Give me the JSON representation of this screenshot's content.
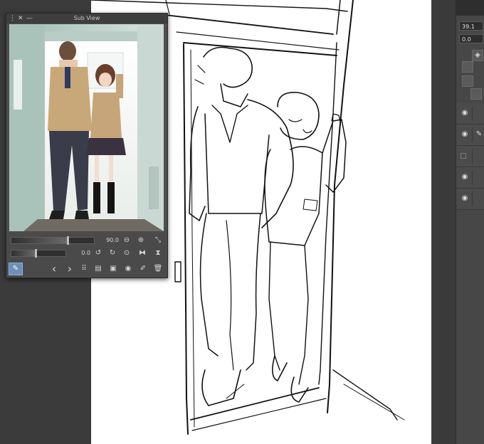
{
  "subview": {
    "title": "Sub View",
    "close_glyph": "✕",
    "minimize_glyph": "—",
    "zoom_value": "90.0",
    "rotate_value": "0.0",
    "zoom_level": 0.68,
    "rotate_level": 0.45
  },
  "right_panel": {
    "field1": "39.1",
    "field2": "0.0"
  },
  "icons": {
    "zoom_out": "⊖",
    "zoom_in": "⊕",
    "fit": "⤡",
    "rotate_left": "↺",
    "rotate_right": "↻",
    "reset": "⊙",
    "flip_h": "⧓",
    "flip_v": "⧗",
    "eyedropper": "✎",
    "prev": "‹",
    "next": "›",
    "grid": "⠿",
    "import": "▤",
    "add_image": "▣",
    "camera": "◉",
    "edit": "✐",
    "trash": "🗑",
    "eye": "◉",
    "pen": "✎",
    "layers": "◈"
  },
  "colors": {
    "accent": "#6d8fb8",
    "panel": "#4d4d4d",
    "canvas": "#ffffff"
  }
}
